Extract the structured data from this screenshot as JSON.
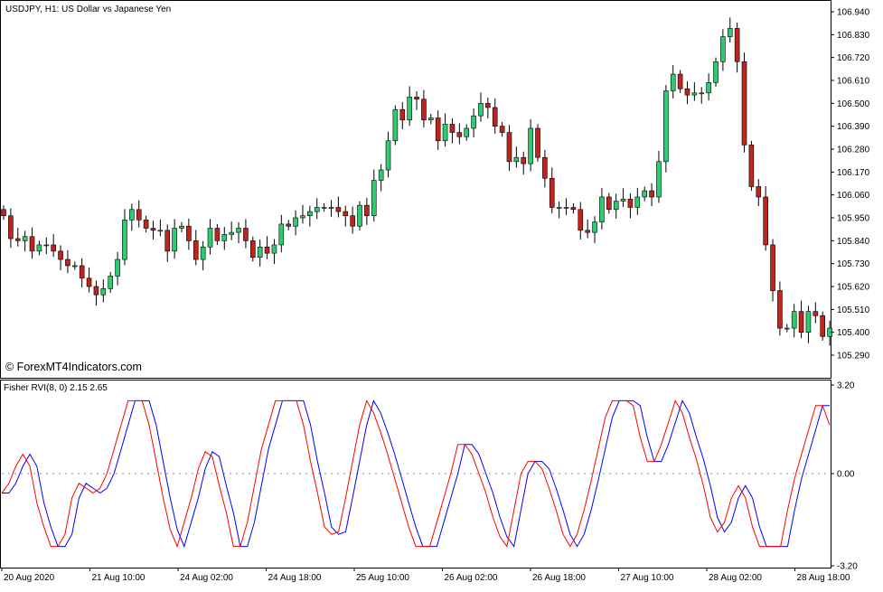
{
  "main_chart": {
    "title": "USDJPY, H1:  US Dollar vs Japanese Yen",
    "watermark": "© ForexMT4Indicators.com",
    "price_axis": [
      "106.940",
      "106.830",
      "106.720",
      "106.610",
      "106.500",
      "106.390",
      "106.280",
      "106.170",
      "106.060",
      "105.950",
      "105.840",
      "105.730",
      "105.620",
      "105.510",
      "105.400",
      "105.290"
    ],
    "price_range": [
      105.29,
      106.94
    ],
    "colors": {
      "bull": "#2ecc71",
      "bear": "#c0241a",
      "wick": "#000000"
    }
  },
  "indicator": {
    "title": "Fisher RVI(8, 0) 2.15 2.65",
    "axis_labels": [
      "3.20",
      "0.00",
      "-3.20"
    ],
    "range": [
      -3.2,
      3.2
    ],
    "colors": {
      "signal": "#ff0000",
      "main": "#0000ff"
    }
  },
  "time_axis": [
    "20 Aug 2020",
    "21 Aug 10:00",
    "24 Aug 02:00",
    "24 Aug 18:00",
    "25 Aug 10:00",
    "26 Aug 02:00",
    "26 Aug 18:00",
    "27 Aug 10:00",
    "28 Aug 02:00",
    "28 Aug 18:00"
  ],
  "chart_data": [
    {
      "type": "candlestick",
      "symbol": "USDJPY",
      "timeframe": "H1",
      "title": "USDJPY, H1:  US Dollar vs Japanese Yen",
      "ylim": [
        105.29,
        106.94
      ],
      "x_tick_labels": [
        "20 Aug 2020",
        "21 Aug 10:00",
        "24 Aug 02:00",
        "24 Aug 18:00",
        "25 Aug 10:00",
        "26 Aug 02:00",
        "26 Aug 18:00",
        "27 Aug 10:00",
        "28 Aug 02:00",
        "28 Aug 18:00"
      ],
      "close": [
        105.96,
        105.85,
        105.84,
        105.86,
        105.79,
        105.82,
        105.82,
        105.79,
        105.75,
        105.72,
        105.72,
        105.66,
        105.62,
        105.58,
        105.61,
        105.67,
        105.75,
        105.94,
        105.99,
        105.94,
        105.9,
        105.89,
        105.89,
        105.79,
        105.9,
        105.91,
        105.84,
        105.75,
        105.81,
        105.9,
        105.84,
        105.87,
        105.88,
        105.9,
        105.84,
        105.76,
        105.81,
        105.78,
        105.82,
        105.92,
        105.91,
        105.95,
        105.96,
        105.98,
        106.0,
        106.0,
        106.0,
        105.98,
        105.96,
        105.91,
        106.01,
        105.96,
        106.13,
        106.18,
        106.32,
        106.47,
        106.42,
        106.53,
        106.52,
        106.42,
        106.43,
        106.32,
        106.4,
        106.36,
        106.34,
        106.38,
        106.44,
        106.5,
        106.48,
        106.39,
        106.36,
        106.22,
        106.24,
        106.21,
        106.38,
        106.24,
        106.14,
        106.0,
        106.0,
        106.0,
        105.99,
        105.89,
        105.88,
        105.93,
        106.05,
        105.99,
        106.03,
        106.04,
        106.0,
        106.05,
        106.08,
        106.05,
        106.22,
        106.56,
        106.64,
        106.57,
        106.54,
        106.55,
        106.55,
        106.6,
        106.7,
        106.82,
        106.86,
        106.7,
        106.3,
        106.1,
        106.05,
        105.82,
        105.6,
        105.42,
        105.42,
        105.5,
        105.4,
        105.5,
        105.48,
        105.38,
        105.42
      ],
      "indicator": {
        "name": "Fisher RVI",
        "params": "(8, 0)",
        "levels": [
          2.15,
          2.65
        ],
        "range": [
          -3.2,
          3.2
        ],
        "series_colors": [
          "red",
          "blue"
        ],
        "signal_red": [
          -0.8,
          -0.4,
          0.3,
          0.8,
          0.3,
          -1.2,
          -2.2,
          -3.0,
          -3.0,
          -2.5,
          -1.0,
          -0.4,
          -0.6,
          -0.8,
          -0.6,
          0.0,
          1.0,
          2.0,
          3.0,
          3.0,
          3.0,
          2.0,
          0.5,
          -1.0,
          -2.3,
          -3.0,
          -2.0,
          -1.0,
          0.2,
          0.9,
          0.7,
          -0.5,
          -1.6,
          -3.0,
          -3.0,
          -2.0,
          -0.5,
          1.0,
          2.0,
          3.0,
          3.0,
          3.0,
          3.0,
          2.0,
          0.5,
          -0.8,
          -2.2,
          -2.5,
          -2.4,
          -1.0,
          0.5,
          2.0,
          3.0,
          2.5,
          1.7,
          0.8,
          -0.2,
          -1.2,
          -2.2,
          -3.0,
          -3.0,
          -3.0,
          -2.0,
          -1.0,
          0.0,
          1.2,
          1.2,
          0.8,
          0.0,
          -0.8,
          -1.8,
          -2.6,
          -3.0,
          -1.5,
          0.0,
          0.5,
          0.5,
          0.2,
          -0.6,
          -1.5,
          -2.5,
          -3.0,
          -2.5,
          -1.5,
          -0.3,
          1.0,
          2.3,
          3.0,
          3.0,
          3.0,
          2.8,
          1.5,
          0.5,
          0.5,
          1.2,
          2.1,
          3.0,
          2.5,
          1.5,
          0.6,
          -0.5,
          -1.8,
          -2.4,
          -2.0,
          -1.0,
          -0.5,
          -1.0,
          -2.2,
          -3.0,
          -3.0,
          -3.0,
          -3.0,
          -1.5,
          -0.2,
          0.8,
          1.8,
          2.8,
          2.8,
          2.0
        ]
      }
    }
  ]
}
